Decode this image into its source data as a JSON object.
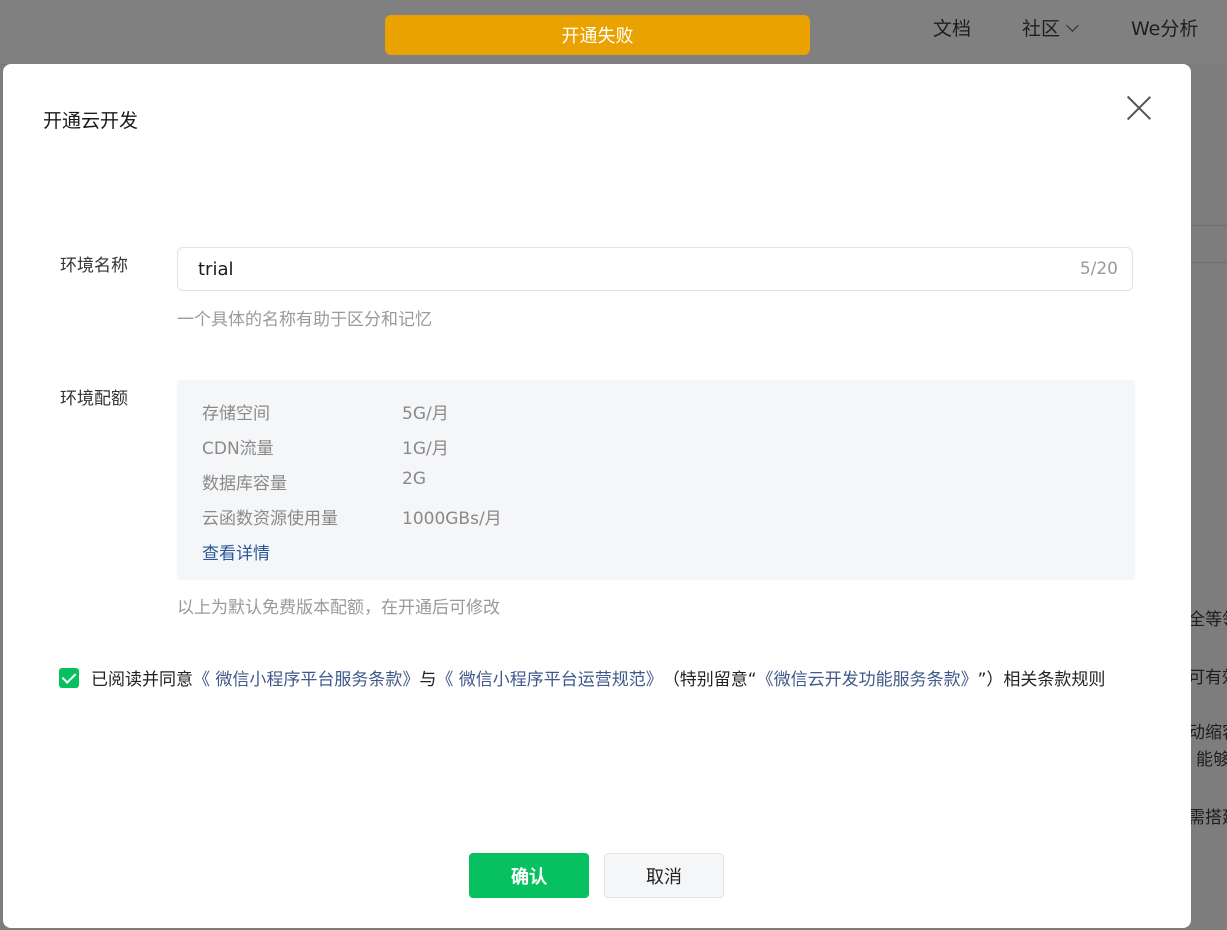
{
  "header": {
    "nav": {
      "docs": "文档",
      "community": "社区",
      "analytics": "We分析"
    }
  },
  "toast": {
    "text": "开通失败"
  },
  "background_fragments": [
    "全等领",
    "可有效",
    "动缩容",
    "能够",
    "需搭建"
  ],
  "modal": {
    "title": "开通云开发",
    "env_name": {
      "label": "环境名称",
      "value": "trial",
      "counter": "5/20",
      "hint": "一个具体的名称有助于区分和记忆"
    },
    "env_quota": {
      "label": "环境配额",
      "rows": [
        {
          "key": "存储空间",
          "value": "5G/月"
        },
        {
          "key": "CDN流量",
          "value": "1G/月"
        },
        {
          "key": "数据库容量",
          "value": "2G"
        },
        {
          "key": "云函数资源使用量",
          "value": "1000GBs/月"
        }
      ],
      "details_link": "查看详情",
      "hint": "以上为默认免费版本配额，在开通后可修改"
    },
    "agreement": {
      "checked": true,
      "prefix": "已阅读并同意",
      "link1": "《 微信小程序平台服务条款》",
      "mid1": "与",
      "link2": "《 微信小程序平台运营规范》",
      "mid2": "（特别留意“",
      "link3": "《微信云开发功能服务条款》",
      "suffix": "”）相关条款规则"
    },
    "buttons": {
      "confirm": "确认",
      "cancel": "取消"
    }
  },
  "colors": {
    "primary": "#07c160",
    "warning": "#eaa200",
    "link": "#40598a"
  }
}
